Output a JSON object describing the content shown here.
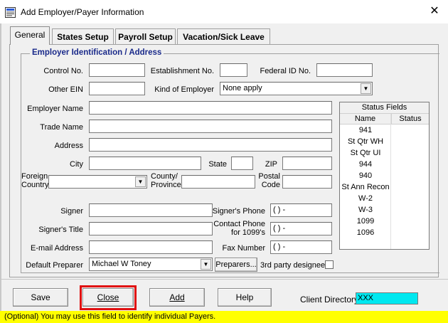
{
  "window": {
    "title": "Add Employer/Payer Information",
    "close_glyph": "✕"
  },
  "tabs": [
    {
      "label": "General",
      "active": true
    },
    {
      "label": "States Setup",
      "active": false
    },
    {
      "label": "Payroll Setup",
      "active": false
    },
    {
      "label": "Vacation/Sick Leave",
      "active": false
    }
  ],
  "group": {
    "legend": "Employer Identification / Address"
  },
  "fields": {
    "control_no": {
      "label": "Control No.",
      "value": ""
    },
    "establishment_no": {
      "label": "Establishment No.",
      "value": ""
    },
    "federal_id": {
      "label": "Federal ID No.",
      "value": ""
    },
    "other_ein": {
      "label": "Other EIN",
      "value": ""
    },
    "kind_of_employer": {
      "label": "Kind of Employer",
      "value": "None apply"
    },
    "employer_name": {
      "label": "Employer Name",
      "value": ""
    },
    "trade_name": {
      "label": "Trade Name",
      "value": ""
    },
    "address": {
      "label": "Address",
      "value": ""
    },
    "city": {
      "label": "City",
      "value": ""
    },
    "state": {
      "label": "State",
      "value": ""
    },
    "zip": {
      "label": "ZIP",
      "value": ""
    },
    "foreign_country": {
      "label_line1": "Foreign",
      "label_line2": "Country",
      "value": ""
    },
    "county_province": {
      "label_line1": "County/",
      "label_line2": "Province",
      "value": ""
    },
    "postal_code": {
      "label_line1": "Postal",
      "label_line2": "Code",
      "value": ""
    },
    "signer": {
      "label": "Signer",
      "value": ""
    },
    "signers_phone": {
      "label": "Signer's Phone",
      "value": "(   )    -"
    },
    "signers_title": {
      "label": "Signer's Title",
      "value": ""
    },
    "contact_phone": {
      "label_line1": "Contact Phone",
      "label_line2": "for 1099's",
      "value": "(   )    -"
    },
    "email": {
      "label": "E-mail Address",
      "value": ""
    },
    "fax": {
      "label": "Fax Number",
      "value": "(   )    -"
    },
    "default_preparer": {
      "label": "Default Preparer",
      "value": "Michael W Toney"
    }
  },
  "preparers_button": "Preparers...",
  "third_party": {
    "label": "3rd party designee",
    "checked": false
  },
  "status_fields": {
    "title": "Status Fields",
    "col_name": "Name",
    "col_status": "Status",
    "rows": [
      {
        "name": "941",
        "status": ""
      },
      {
        "name": "St Qtr WH",
        "status": ""
      },
      {
        "name": "St Qtr UI",
        "status": ""
      },
      {
        "name": "944",
        "status": ""
      },
      {
        "name": "940",
        "status": ""
      },
      {
        "name": "St Ann Recon",
        "status": ""
      },
      {
        "name": "W-2",
        "status": ""
      },
      {
        "name": "W-3",
        "status": ""
      },
      {
        "name": "1099",
        "status": ""
      },
      {
        "name": "1096",
        "status": ""
      }
    ]
  },
  "buttons": {
    "save": "Save",
    "close": "Close",
    "add": "Add",
    "help": "Help"
  },
  "client_directory": {
    "label": "Client Directory",
    "value": "XXX",
    "color": "#00e8f0"
  },
  "status_bar": {
    "text": "(Optional) You may use this field to identify individual Payers.",
    "color": "#ffff00"
  },
  "icons": {
    "dropdown": "▼",
    "app": "form-icon"
  }
}
